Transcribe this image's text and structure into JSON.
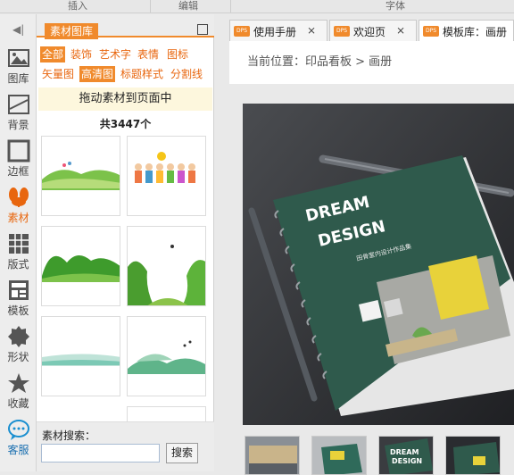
{
  "ribbon": {
    "groups": [
      "插入",
      "编辑",
      "字体"
    ]
  },
  "sidebar": {
    "items": [
      {
        "label": "图库",
        "icon": "gallery-icon"
      },
      {
        "label": "背景",
        "icon": "background-icon"
      },
      {
        "label": "边框",
        "icon": "border-icon"
      },
      {
        "label": "素材",
        "icon": "material-icon",
        "active": true
      },
      {
        "label": "版式",
        "icon": "layout-icon"
      },
      {
        "label": "模板",
        "icon": "template-icon"
      },
      {
        "label": "形状",
        "icon": "shape-icon"
      },
      {
        "label": "收藏",
        "icon": "star-icon"
      },
      {
        "label": "客服",
        "icon": "chat-icon"
      }
    ]
  },
  "panel": {
    "title": "素材图库",
    "categories": [
      "全部",
      "装饰",
      "艺术字",
      "表情",
      "图标",
      "矢量图",
      "高清图",
      "标题样式",
      "分割线"
    ],
    "drag_hint": "拖动素材到页面中",
    "count": "共3447个",
    "search_label": "素材搜索：",
    "search_value": "",
    "search_button": "搜索"
  },
  "tabs": [
    {
      "badge": "DPS",
      "label": "使用手册",
      "close": "⨯"
    },
    {
      "badge": "DPS",
      "label": "欢迎页",
      "close": "⨯"
    },
    {
      "badge": "DPS",
      "label": "模板库：画册"
    }
  ],
  "breadcrumb": "当前位置：印品看板 > 画册",
  "cover": {
    "line1": "DREAM",
    "line2": "DESIGN",
    "subtitle": "田骨室内设计作品集"
  },
  "accent": "#f08a2c"
}
